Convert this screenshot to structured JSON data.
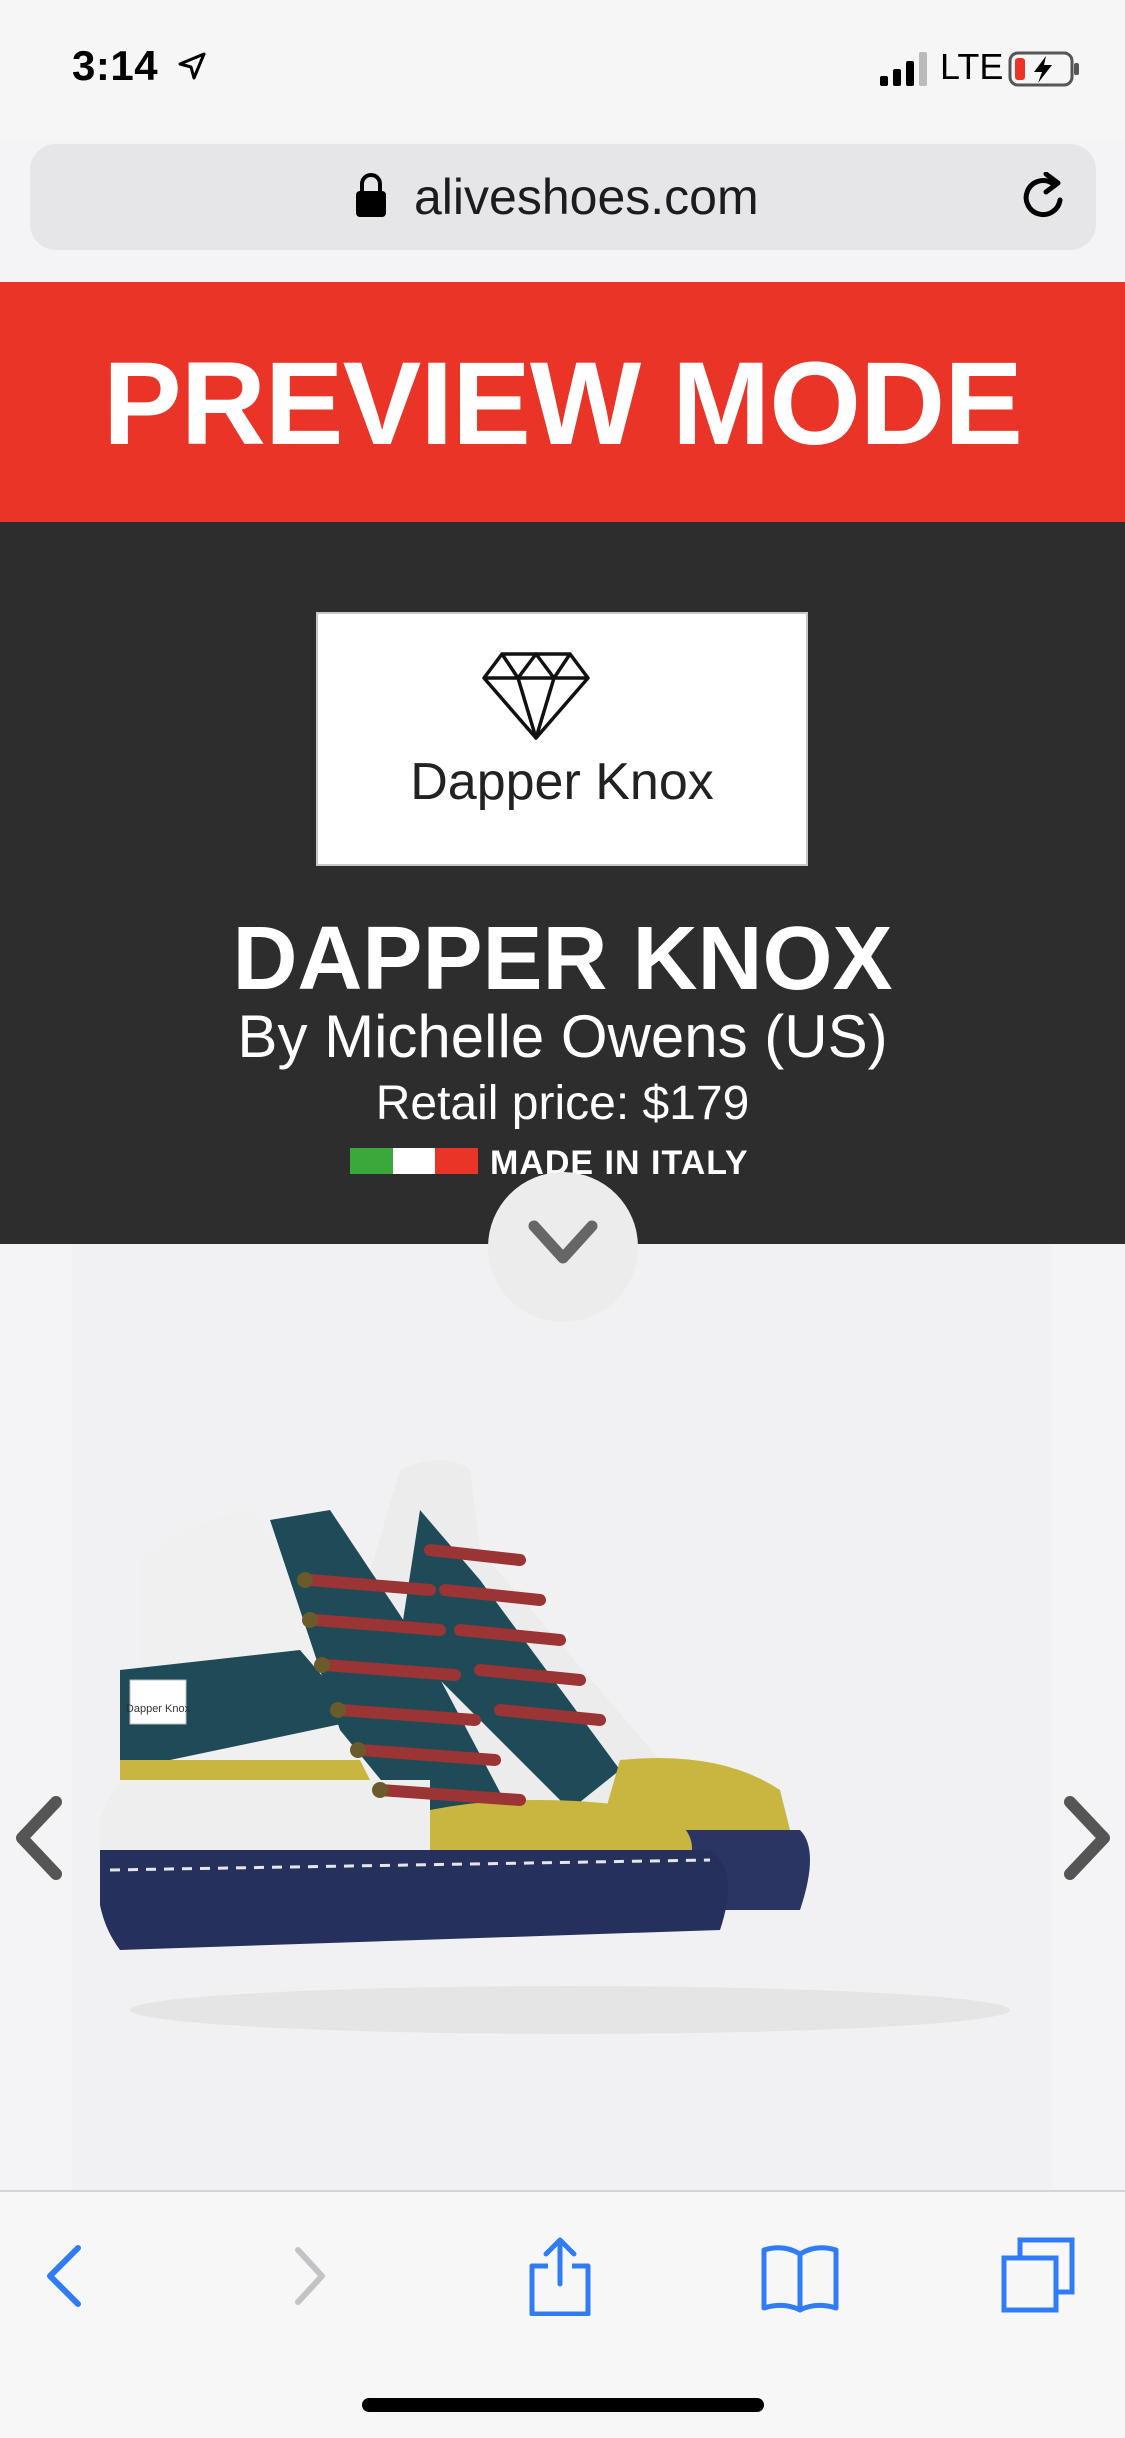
{
  "status_bar": {
    "time": "3:14",
    "carrier": "LTE"
  },
  "browser": {
    "url": "aliveshoes.com"
  },
  "banner": {
    "text": "PREVIEW MODE"
  },
  "header": {
    "logo_text": "Dapper Knox",
    "title": "DAPPER KNOX",
    "designer": "By Michelle Owens (US)",
    "price": "Retail price: $179",
    "origin": "MADE IN ITALY"
  },
  "product": {
    "logo_tag": "Dapper Knox"
  },
  "colors": {
    "banner_red": "#e93427",
    "header_dark": "#2d2d2d",
    "ios_blue": "#2f7cf6",
    "flag_green": "#3aa83a",
    "flag_white": "#ffffff",
    "flag_red": "#e93427"
  },
  "icons": [
    "location-arrow-icon",
    "signal-icon",
    "battery-charging-icon",
    "lock-icon",
    "reload-icon",
    "diamond-icon",
    "chevron-down-icon",
    "chevron-left-icon",
    "chevron-right-icon",
    "back-icon",
    "forward-icon",
    "share-icon",
    "bookmarks-icon",
    "tabs-icon"
  ]
}
